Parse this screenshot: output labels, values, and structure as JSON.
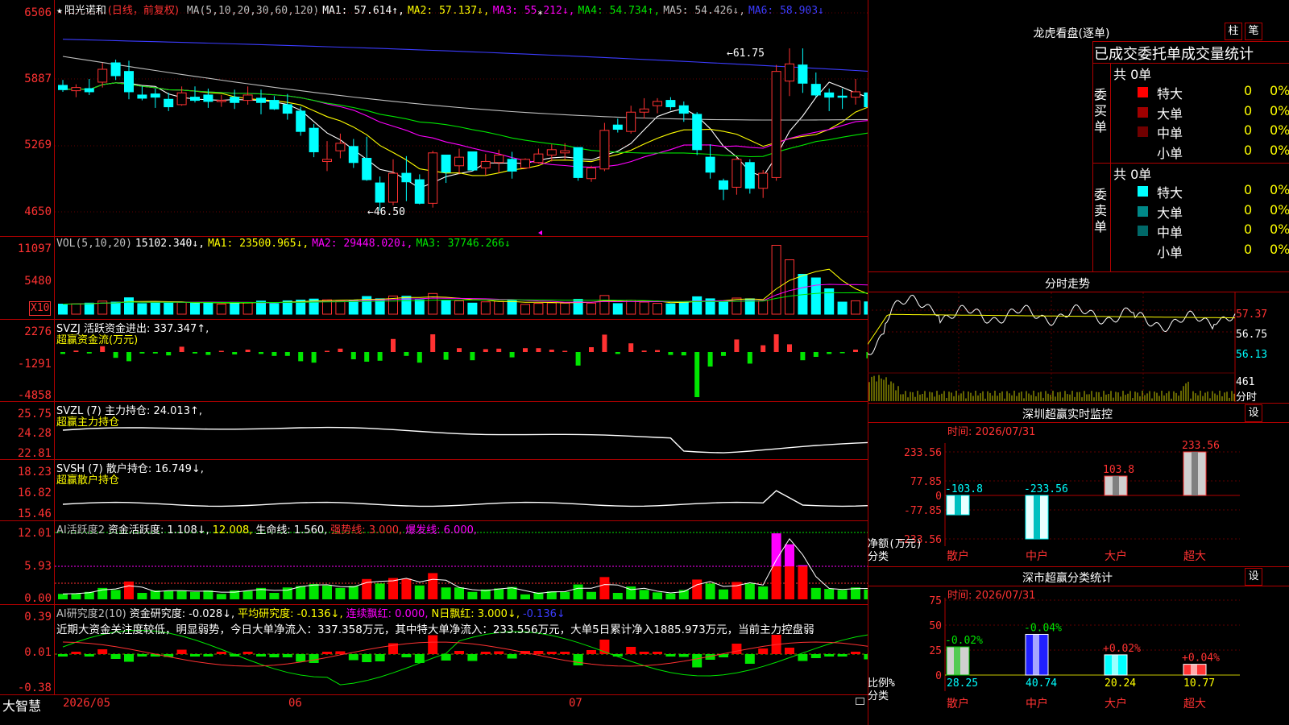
{
  "stock": {
    "star": "★",
    "name": "阳光诺和",
    "period": "(日线，前复权)"
  },
  "price_axis": [
    "6506",
    "5887",
    "5269",
    "4650"
  ],
  "ma_legend": [
    {
      "text": "MA(5,10,20,30,60,120)",
      "color": "#c0c0c0"
    },
    {
      "text": "MA1: 57.614↑,",
      "color": "#ffffff"
    },
    {
      "text": "MA2: 57.137↓,",
      "color": "#ffff00"
    },
    {
      "text": "MA3: 55.212↓,",
      "color": "#ff00ff"
    },
    {
      "text": "MA4: 54.734↑,",
      "color": "#00e600"
    },
    {
      "text": "MA5: 54.426↓,",
      "color": "#c0c0c0"
    },
    {
      "text": "MA6: 58.903↓",
      "color": "#3c3cff"
    }
  ],
  "price_annotations": {
    "high": "61.75",
    "low": "46.50"
  },
  "vol": {
    "axis": [
      "11097",
      "5480"
    ],
    "unit": "X10",
    "legend": [
      {
        "text": "VOL(5,10,20)",
        "color": "#c0c0c0"
      },
      {
        "text": "15102.340↓,",
        "color": "#ffffff"
      },
      {
        "text": "MA1: 23500.965↓,",
        "color": "#ffff00"
      },
      {
        "text": "MA2: 29448.020↓,",
        "color": "#ff00ff"
      },
      {
        "text": "MA3: 37746.266↓",
        "color": "#00e600"
      }
    ]
  },
  "svzj": {
    "axis": [
      "2276",
      "-1291",
      "-4858"
    ],
    "line1": "SVZJ  活跃资金进出: 337.347↑,",
    "line2": "超赢资金流(万元)"
  },
  "svzl": {
    "axis": [
      "25.75",
      "24.28",
      "22.81"
    ],
    "line1": "SVZL (7) 主力持仓: 24.013↑,",
    "line2": "超赢主力持仓"
  },
  "svsh": {
    "axis": [
      "18.23",
      "16.82",
      "15.46"
    ],
    "line1": "SVSH (7) 散户持仓: 16.749↓,",
    "line2": "超赢散户持仓"
  },
  "ai1": {
    "axis": [
      "12.01",
      "5.93",
      "0.00"
    ],
    "legend": [
      {
        "text": "AI活跃度2",
        "color": "#c0c0c0"
      },
      {
        "text": "资金活跃度: 1.108↓,",
        "color": "#ffffff"
      },
      {
        "text": "12.008,",
        "color": "#ffff00"
      },
      {
        "text": "生命线: 1.560,",
        "color": "#ffffff"
      },
      {
        "text": "强势线: 3.000,",
        "color": "#ff3232"
      },
      {
        "text": "爆发线: 6.000,",
        "color": "#ff00ff"
      }
    ]
  },
  "ai2": {
    "axis": [
      "0.39",
      "0.01",
      "-0.38"
    ],
    "legend": [
      {
        "text": "AI研究度2(10)",
        "color": "#c0c0c0"
      },
      {
        "text": "资金研究度: -0.028↓,",
        "color": "#ffffff"
      },
      {
        "text": "平均研究度: -0.136↓,",
        "color": "#ffff00"
      },
      {
        "text": "连续飘红: 0.000,",
        "color": "#ff00ff"
      },
      {
        "text": "N日飘红: 3.000↓,",
        "color": "#ffff00"
      },
      {
        "text": "-0.136↓",
        "color": "#3c3cff"
      }
    ],
    "comment": "近期大资金关注度较低，明显弱势，今日大单净流入：337.358万元，其中特大单净流入：233.556万元，大单5日累计净入1885.973万元，当前主力控盘弱"
  },
  "date_axis": [
    "2026/05",
    "06",
    "07"
  ],
  "brand": "大智慧",
  "right": {
    "lhk_title": "龙虎看盘(逐单)",
    "btn_bar": "柱",
    "btn_pen": "笔",
    "subtitle": "已成交委托单成交量统计",
    "buy": {
      "side_label": "委买单",
      "total": "共 0单",
      "rows": [
        {
          "label": "特大",
          "color": "#ff0000",
          "v1": "0",
          "v2": "0%"
        },
        {
          "label": "大单",
          "color": "#a00000",
          "v1": "0",
          "v2": "0%"
        },
        {
          "label": "中单",
          "color": "#700000",
          "v1": "0",
          "v2": "0%"
        },
        {
          "label": "小单",
          "color": "#000000",
          "v1": "0",
          "v2": "0%"
        }
      ]
    },
    "sell": {
      "side_label": "委卖单",
      "total": "共 0单",
      "rows": [
        {
          "label": "特大",
          "color": "#00ffff",
          "v1": "0",
          "v2": "0%"
        },
        {
          "label": "大单",
          "color": "#008888",
          "v1": "0",
          "v2": "0%"
        },
        {
          "label": "中单",
          "color": "#006868",
          "v1": "0",
          "v2": "0%"
        },
        {
          "label": "小单",
          "color": "#000000",
          "v1": "0",
          "v2": "0%"
        }
      ]
    },
    "intraday": {
      "title": "分时走势",
      "prices": [
        "57.37",
        "56.75",
        "56.13"
      ],
      "vol": "461",
      "vol_label": "分时"
    },
    "monitor": {
      "title": "深圳超赢实时监控",
      "set_btn": "设",
      "time": "时间: 2026/07/31",
      "axis": [
        "233.56",
        "77.85",
        "0",
        "-77.85",
        "-233.56"
      ],
      "ylabel": "净额(万元)",
      "xlabel": "分类",
      "categories": [
        "散户",
        "中户",
        "大户",
        "超大"
      ],
      "values": [
        -103.8,
        -233.56,
        103.8,
        233.56
      ],
      "value_labels": [
        "-103.8",
        "-233.56",
        "103.8",
        "233.56"
      ]
    },
    "stats": {
      "title": "深市超赢分类统计",
      "set_btn": "设",
      "time": "时间: 2026/07/31",
      "axis": [
        "75",
        "50",
        "25",
        "0"
      ],
      "ylabel": "比例%",
      "xlabel": "分类",
      "categories": [
        "散户",
        "中户",
        "大户",
        "超大"
      ],
      "values": [
        28.25,
        40.74,
        20.24,
        10.77
      ],
      "top_labels": [
        "-0.02%",
        "-0.04%",
        "+0.02%",
        "+0.04%"
      ]
    }
  },
  "chart_data": {
    "type": "candlestick",
    "x_start": "2026/05",
    "price_scale_labels": [
      "6506",
      "5887",
      "5269",
      "4650"
    ],
    "candles_ohlc": [
      [
        58.3,
        58.8,
        57.7,
        57.9
      ],
      [
        57.8,
        58.4,
        57.2,
        58.1
      ],
      [
        58.0,
        58.9,
        57.4,
        57.7
      ],
      [
        58.6,
        60.4,
        58.1,
        59.8
      ],
      [
        60.4,
        60.7,
        58.8,
        59.2
      ],
      [
        59.6,
        60.6,
        57.0,
        57.7
      ],
      [
        57.4,
        58.2,
        56.9,
        57.1
      ],
      [
        57.5,
        58.0,
        56.2,
        57.2
      ],
      [
        57.0,
        57.6,
        55.9,
        56.3
      ],
      [
        56.5,
        58.2,
        56.4,
        57.6
      ],
      [
        57.2,
        58.2,
        56.7,
        56.9
      ],
      [
        57.4,
        58.0,
        56.2,
        56.8
      ],
      [
        56.8,
        57.4,
        56.3,
        56.9
      ],
      [
        57.2,
        57.9,
        56.1,
        56.7
      ],
      [
        56.9,
        58.2,
        56.5,
        57.4
      ],
      [
        57.1,
        57.9,
        55.6,
        56.7
      ],
      [
        56.9,
        57.3,
        56.0,
        56.1
      ],
      [
        56.5,
        57.5,
        55.1,
        55.7
      ],
      [
        55.9,
        56.3,
        53.6,
        54.0
      ],
      [
        54.3,
        54.7,
        51.6,
        52.1
      ],
      [
        51.2,
        53.1,
        50.3,
        51.4
      ],
      [
        52.2,
        53.8,
        51.5,
        52.9
      ],
      [
        52.6,
        53.3,
        50.6,
        51.1
      ],
      [
        51.5,
        53.5,
        49.4,
        49.5
      ],
      [
        49.2,
        49.8,
        46.6,
        47.4
      ],
      [
        47.4,
        51.4,
        47.1,
        50.1
      ],
      [
        50.1,
        51.7,
        47.5,
        49.3
      ],
      [
        49.5,
        50.0,
        47.2,
        47.3
      ],
      [
        47.3,
        52.2,
        46.9,
        52.0
      ],
      [
        51.8,
        51.6,
        49.2,
        50.2
      ],
      [
        50.8,
        52.4,
        50.0,
        51.6
      ],
      [
        52.1,
        51.8,
        50.3,
        50.4
      ],
      [
        50.6,
        51.9,
        49.9,
        51.2
      ],
      [
        51.1,
        52.3,
        50.1,
        51.8
      ],
      [
        51.4,
        52.1,
        49.6,
        50.3
      ],
      [
        50.6,
        51.5,
        50.5,
        51.4
      ],
      [
        51.1,
        52.4,
        51.0,
        51.9
      ],
      [
        51.8,
        52.8,
        51.2,
        52.3
      ],
      [
        52.0,
        52.9,
        51.4,
        52.2
      ],
      [
        52.5,
        52.4,
        49.4,
        49.7
      ],
      [
        49.6,
        50.8,
        49.3,
        50.6
      ],
      [
        50.5,
        54.8,
        50.3,
        54.1
      ],
      [
        54.6,
        55.2,
        53.9,
        54.2
      ],
      [
        54.0,
        56.4,
        53.8,
        55.8
      ],
      [
        55.8,
        57.1,
        55.2,
        56.1
      ],
      [
        56.4,
        57.1,
        55.7,
        56.8
      ],
      [
        56.9,
        57.2,
        56.0,
        56.3
      ],
      [
        56.4,
        56.8,
        54.9,
        55.7
      ],
      [
        55.6,
        55.8,
        51.8,
        52.3
      ],
      [
        51.6,
        52.8,
        49.6,
        50.2
      ],
      [
        49.4,
        49.6,
        47.6,
        48.6
      ],
      [
        48.8,
        51.6,
        48.1,
        51.4
      ],
      [
        51.1,
        51.4,
        48.2,
        48.7
      ],
      [
        48.7,
        50.4,
        47.8,
        50.1
      ],
      [
        49.7,
        60.2,
        49.4,
        59.6
      ],
      [
        58.7,
        61.75,
        57.3,
        60.3
      ],
      [
        60.2,
        61.75,
        57.6,
        58.5
      ],
      [
        58.4,
        59.5,
        57.2,
        57.4
      ],
      [
        57.6,
        58.0,
        55.9,
        57.2
      ],
      [
        57.3,
        58.0,
        56.1,
        57.2
      ],
      [
        57.2,
        58.9,
        56.5,
        57.7
      ],
      [
        57.6,
        57.9,
        55.9,
        56.3
      ],
      [
        56.4,
        58.3,
        56.2,
        58.0
      ],
      [
        58.3,
        59.5,
        57.5,
        58.1
      ],
      [
        58.2,
        58.6,
        57.2,
        58.8
      ],
      [
        58.8,
        59.5,
        57.8,
        57.8
      ],
      [
        57.6,
        58.3,
        55.8,
        57.3
      ],
      [
        57.0,
        58.3,
        56.1,
        57.7
      ]
    ]
  }
}
